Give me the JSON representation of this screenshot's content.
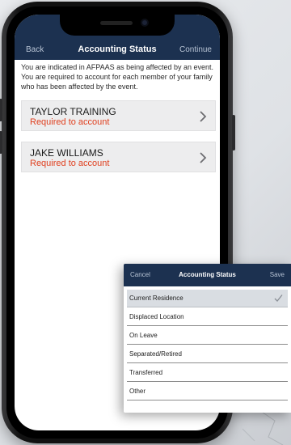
{
  "nav": {
    "back_label": "Back",
    "title": "Accounting Status",
    "continue_label": "Continue"
  },
  "intro_text": "You are indicated in AFPAAS as being affected by an event. You are required to account for each member of your family who has been affected by the event.",
  "members": [
    {
      "name": "TAYLOR TRAINING",
      "status": "Required to account"
    },
    {
      "name": "JAKE WILLIAMS",
      "status": "Required to account"
    }
  ],
  "sheet": {
    "cancel_label": "Cancel",
    "title": "Accounting Status",
    "save_label": "Save",
    "options": [
      {
        "label": "Current Residence",
        "selected": true
      },
      {
        "label": "Displaced Location",
        "selected": false
      },
      {
        "label": "On Leave",
        "selected": false
      },
      {
        "label": "Separated/Retired",
        "selected": false
      },
      {
        "label": "Transferred",
        "selected": false
      },
      {
        "label": "Other",
        "selected": false
      }
    ]
  },
  "colors": {
    "nav_bg": "#1c3150",
    "status_red": "#e0401f",
    "selected_row": "#d9dde2"
  },
  "icons": {
    "row_arrow": "chevron-right-icon",
    "selected_mark": "checkmark-icon"
  }
}
